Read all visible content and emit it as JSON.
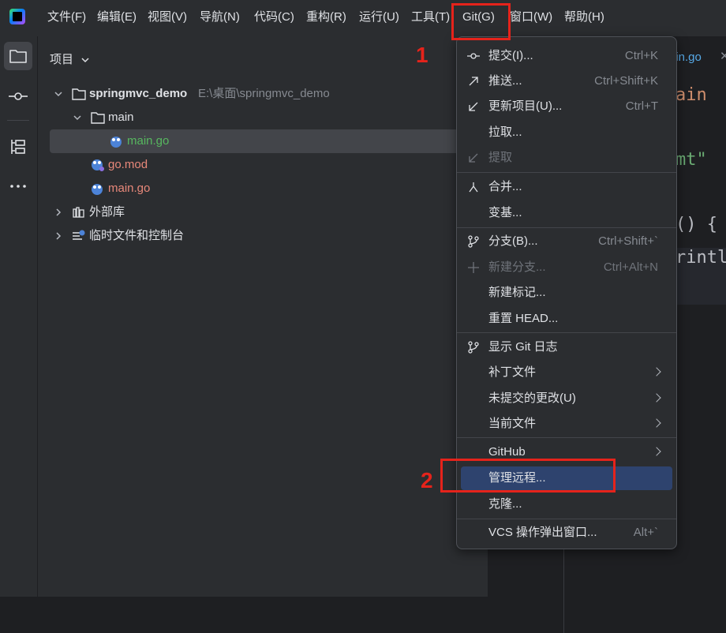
{
  "menubar": {
    "items": [
      "文件(F)",
      "编辑(E)",
      "视图(V)",
      "导航(N)",
      "代码(C)",
      "重构(R)",
      "运行(U)",
      "工具(T)",
      "Git(G)",
      "窗口(W)",
      "帮助(H)"
    ]
  },
  "annotations": {
    "step1": "1",
    "step2": "2"
  },
  "project": {
    "title": "项目",
    "root_name": "springmvc_demo",
    "root_path": "E:\\桌面\\springmvc_demo",
    "folder_main": "main",
    "main_go_inner": "main.go",
    "go_mod": "go.mod",
    "main_go": "main.go",
    "external_libs": "外部库",
    "scratches": "临时文件和控制台"
  },
  "editor": {
    "tab_label": "ain.go",
    "code": [
      "ain",
      "mt\"",
      "() {",
      "rintl"
    ]
  },
  "git_menu": {
    "items": [
      {
        "label": "提交(I)...",
        "shortcut": "Ctrl+K"
      },
      {
        "label": "推送...",
        "shortcut": "Ctrl+Shift+K"
      },
      {
        "label": "更新项目(U)...",
        "shortcut": "Ctrl+T"
      },
      {
        "label": "拉取...",
        "shortcut": ""
      },
      {
        "label": "提取",
        "shortcut": ""
      },
      {
        "label": "合并...",
        "shortcut": ""
      },
      {
        "label": "变基...",
        "shortcut": ""
      },
      {
        "label": "分支(B)...",
        "shortcut": "Ctrl+Shift+`"
      },
      {
        "label": "新建分支...",
        "shortcut": "Ctrl+Alt+N"
      },
      {
        "label": "新建标记...",
        "shortcut": ""
      },
      {
        "label": "重置 HEAD...",
        "shortcut": ""
      },
      {
        "label": "显示 Git 日志",
        "shortcut": ""
      },
      {
        "label": "补丁文件",
        "shortcut": ""
      },
      {
        "label": "未提交的更改(U)",
        "shortcut": ""
      },
      {
        "label": "当前文件",
        "shortcut": ""
      },
      {
        "label": "GitHub",
        "shortcut": ""
      },
      {
        "label": "管理远程...",
        "shortcut": ""
      },
      {
        "label": "克隆...",
        "shortcut": ""
      },
      {
        "label": "VCS 操作弹出窗口...",
        "shortcut": "Alt+`"
      }
    ]
  },
  "colors": {
    "accent_red": "#e5231b",
    "hover_blue": "#2e436e",
    "go_file_red": "#e8887a",
    "go_file_green": "#57b85f"
  }
}
